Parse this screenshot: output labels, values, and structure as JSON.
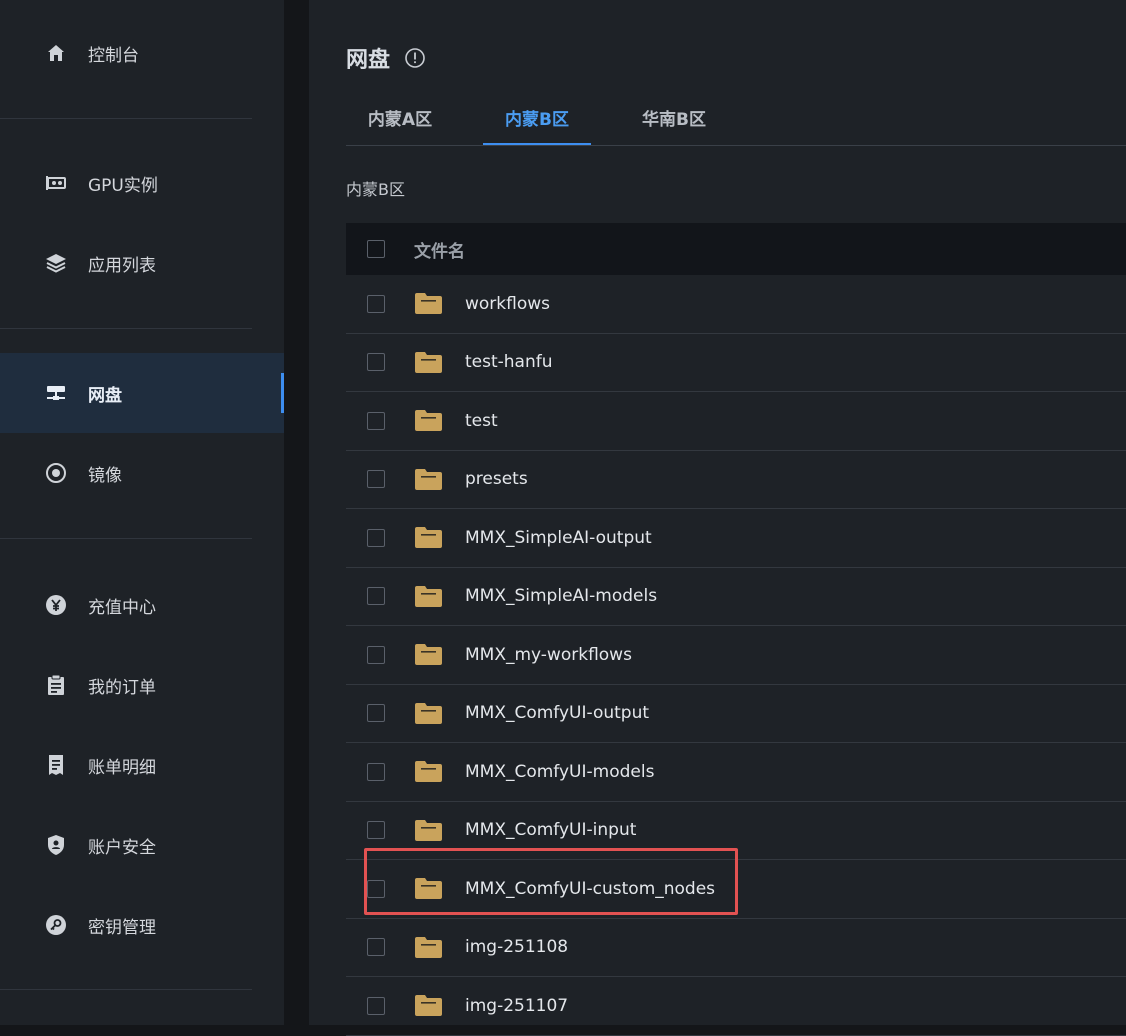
{
  "sidebar": {
    "items": [
      {
        "label": "控制台",
        "icon": "home-icon"
      },
      {
        "label": "GPU实例",
        "icon": "gpu-card-icon"
      },
      {
        "label": "应用列表",
        "icon": "layers-icon"
      },
      {
        "label": "网盘",
        "icon": "network-disk-icon",
        "active": true
      },
      {
        "label": "镜像",
        "icon": "radio-disc-icon"
      },
      {
        "label": "充值中心",
        "icon": "yen-coin-icon"
      },
      {
        "label": "我的订单",
        "icon": "clipboard-icon"
      },
      {
        "label": "账单明细",
        "icon": "receipt-icon"
      },
      {
        "label": "账户安全",
        "icon": "shield-user-icon"
      },
      {
        "label": "密钥管理",
        "icon": "key-icon"
      }
    ]
  },
  "page": {
    "title": "网盘",
    "tabs": [
      {
        "label": "内蒙A区"
      },
      {
        "label": "内蒙B区",
        "active": true
      },
      {
        "label": "华南B区"
      }
    ],
    "section_label": "内蒙B区"
  },
  "table": {
    "header": "文件名",
    "rows": [
      {
        "name": "workflows"
      },
      {
        "name": "test-hanfu"
      },
      {
        "name": "test"
      },
      {
        "name": "presets"
      },
      {
        "name": "MMX_SimpleAI-output"
      },
      {
        "name": "MMX_SimpleAI-models"
      },
      {
        "name": "MMX_my-workflows"
      },
      {
        "name": "MMX_ComfyUI-output"
      },
      {
        "name": "MMX_ComfyUI-models"
      },
      {
        "name": "MMX_ComfyUI-input"
      },
      {
        "name": "MMX_ComfyUI-custom_nodes"
      },
      {
        "name": "img-251108"
      },
      {
        "name": "img-251107"
      }
    ]
  },
  "colors": {
    "accent": "#3d8ef0",
    "folder": "#c9a35c",
    "highlight_box": "#e25252"
  }
}
